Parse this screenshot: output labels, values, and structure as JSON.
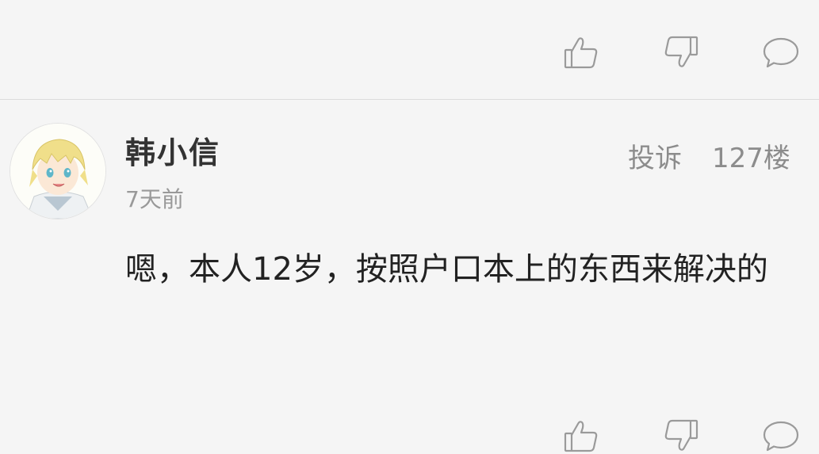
{
  "comment": {
    "username": "韩小信",
    "time": "7天前",
    "report_label": "投诉",
    "floor": "127楼",
    "text": "嗯，本人12岁，按照户口本上的东西来解决的"
  },
  "actions": {
    "like_icon": "thumbs-up-icon",
    "dislike_icon": "thumbs-down-icon",
    "reply_icon": "comment-bubble-icon"
  }
}
